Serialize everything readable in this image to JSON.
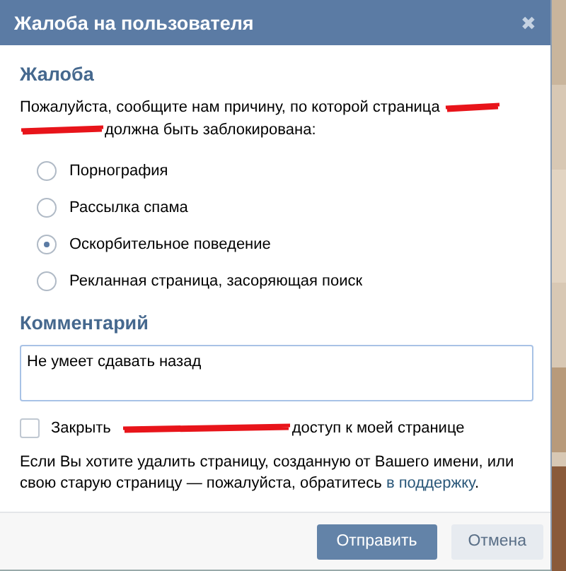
{
  "dialog": {
    "title": "Жалоба на пользователя",
    "close": "✖"
  },
  "complaint": {
    "heading": "Жалоба",
    "intro_before": "Пожалуйста, сообщите нам причину, по которой страница",
    "intro_after": "должна быть заблокирована:"
  },
  "reasons": [
    {
      "label": "Порнография",
      "selected": false
    },
    {
      "label": "Рассылка спама",
      "selected": false
    },
    {
      "label": "Оскорбительное поведение",
      "selected": true
    },
    {
      "label": "Рекланная страница, засоряющая поиск",
      "selected": false
    }
  ],
  "comment": {
    "heading": "Комментарий",
    "value": "Не умеет сдавать назад"
  },
  "close_access": {
    "checked": false,
    "before": "Закрыть",
    "after": "доступ к моей странице"
  },
  "note": {
    "text": "Если Вы хотите удалить страницу, созданную от Вашего имени, или свою старую страницу — пожалуйста, обратитесь",
    "link": "в поддержку",
    "end": "."
  },
  "buttons": [
    {
      "label": "Отправить",
      "kind": "primary"
    },
    {
      "label": "Отмена",
      "kind": "secondary"
    }
  ]
}
